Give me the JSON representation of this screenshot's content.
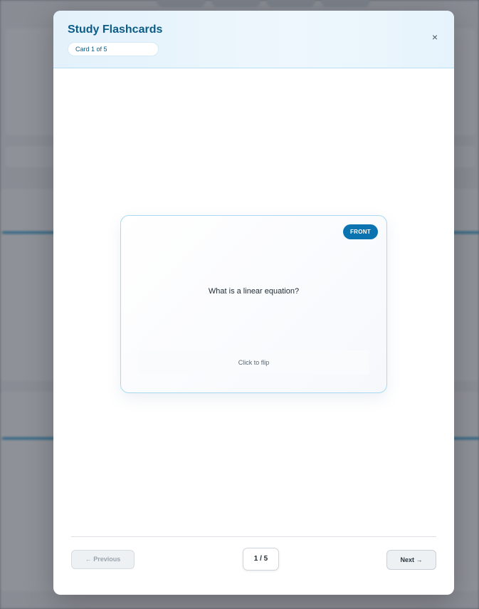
{
  "modal": {
    "title": "Study Flashcards",
    "counter": "Card 1 of 5",
    "close_icon": "×"
  },
  "flashcard": {
    "side_badge": "FRONT",
    "question": "What is a linear equation?",
    "flip_hint": "Click to flip"
  },
  "navigation": {
    "previous_label": "← Previous",
    "page_indicator": "1 / 5",
    "next_label": "Next →"
  },
  "colors": {
    "accent": "#0b74b0",
    "title": "#0b5c86",
    "card_border": "#a9daf2"
  }
}
